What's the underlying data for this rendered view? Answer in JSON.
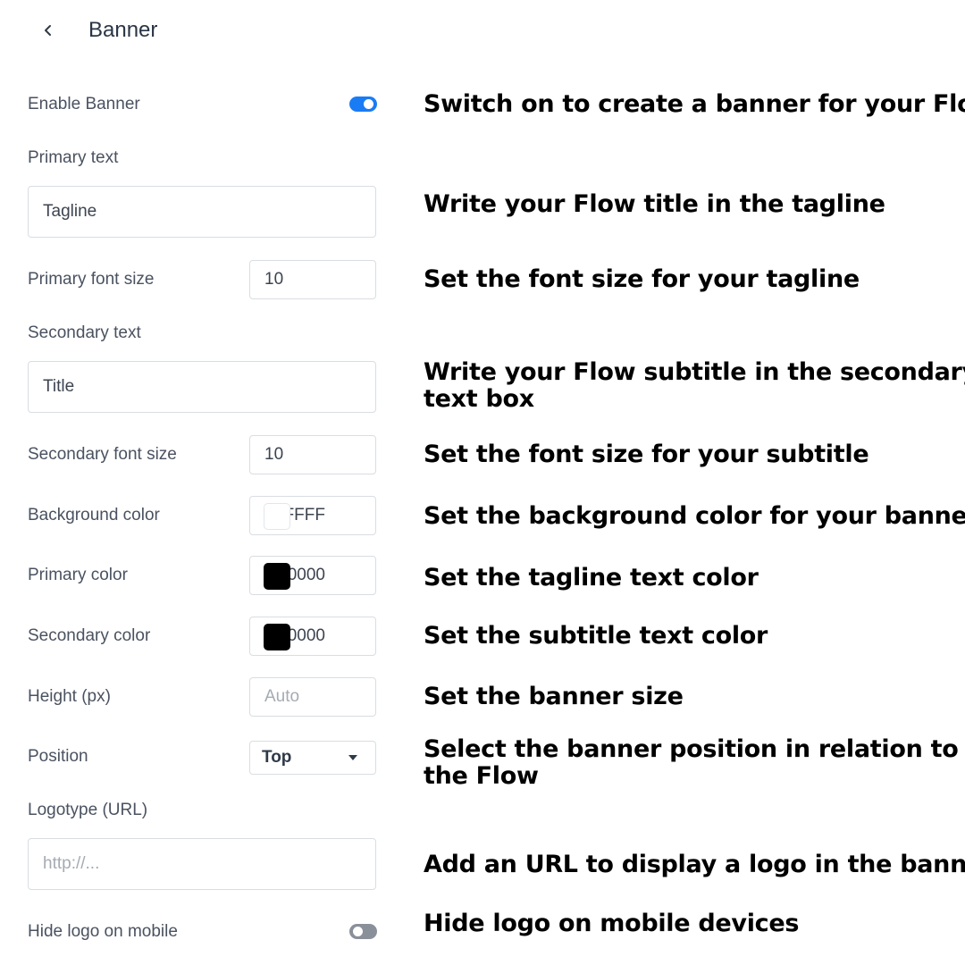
{
  "header": {
    "title": "Banner",
    "back_icon": "chevron-left-icon"
  },
  "form": {
    "enable_banner": {
      "label": "Enable Banner",
      "checked": true,
      "on_color": "#1a7cf5"
    },
    "primary_text": {
      "label": "Primary text",
      "value": "Tagline"
    },
    "primary_font_size": {
      "label": "Primary font size",
      "value": "10"
    },
    "secondary_text": {
      "label": "Secondary text",
      "value": "Title"
    },
    "secondary_font_size": {
      "label": "Secondary font size",
      "value": "10"
    },
    "background_color": {
      "label": "Background color",
      "hex": "FFFF",
      "swatch": "#ffffff"
    },
    "primary_color": {
      "label": "Primary color",
      "hex": "0000",
      "swatch": "#000000"
    },
    "secondary_color": {
      "label": "Secondary color",
      "hex": "0000",
      "swatch": "#000000"
    },
    "height": {
      "label": "Height (px)",
      "placeholder": "Auto"
    },
    "position": {
      "label": "Position",
      "selected": "Top",
      "icon": "caret-down-icon"
    },
    "logotype": {
      "label": "Logotype (URL)",
      "placeholder": "http://..."
    },
    "hide_logo_mobile": {
      "label": "Hide logo on mobile",
      "checked": false,
      "off_color": "#8a9099"
    }
  },
  "annotations": {
    "enable_banner": "Switch on to create a banner for your Flow",
    "primary_text": "Write your Flow title in the tagline",
    "primary_font_size": "Set the font size for your tagline",
    "secondary_text_line1": "Write your Flow subtitle in the secondary",
    "secondary_text_line2": "text box",
    "secondary_font_size": "Set the font size for your subtitle",
    "background_color": "Set the background color for your banner",
    "primary_color": "Set the tagline text color",
    "secondary_color": "Set the subtitle text color",
    "height": "Set the banner size",
    "position_line1": "Select the banner position in relation to",
    "position_line2": "the Flow",
    "logotype": "Add an URL to display a logo in the banner",
    "hide_logo_mobile": "Hide logo on mobile devices"
  }
}
